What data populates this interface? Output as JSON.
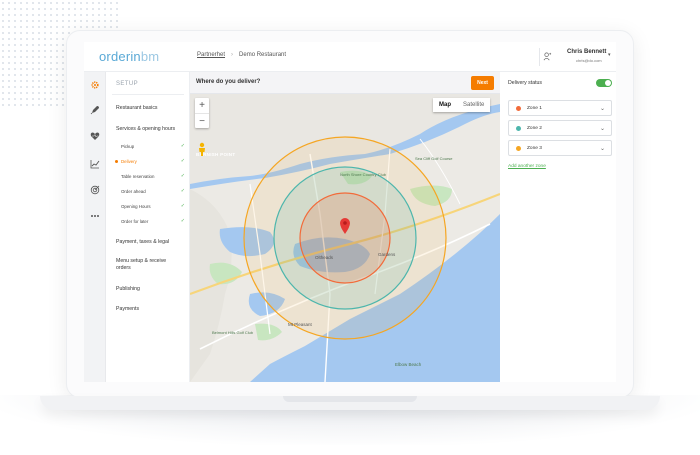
{
  "colors": {
    "accent": "#f57c00",
    "brand": "#5aa9d6",
    "success": "#4caf50",
    "zone1": "#f26b3a",
    "zone2": "#4db6ac",
    "zone3": "#f5a623"
  },
  "header": {
    "logo": {
      "prefix": "orderin",
      "suffix": "bm"
    },
    "breadcrumb": [
      "Partnerhet",
      "Demo Restaurant"
    ],
    "user": {
      "name": "Chris Bennett",
      "email": "chris@do.com"
    }
  },
  "rail": {
    "icons": [
      "gear-icon",
      "rocket-icon",
      "heart-icon",
      "chart-icon",
      "target-icon",
      "more-icon"
    ]
  },
  "nav": {
    "heading": "SETUP",
    "items": {
      "restaurant_basics": "Restaurant basics",
      "services": "Services & opening hours",
      "payment": "Payment, taxes & legal",
      "menu_setup": "Menu setup & receive orders",
      "publishing": "Publishing",
      "payments": "Payments"
    },
    "sub_items": [
      {
        "label": "Pickup",
        "active": false
      },
      {
        "label": "Delivery",
        "active": true
      },
      {
        "label": "Table reservation",
        "active": false
      },
      {
        "label": "Order ahead",
        "active": false
      },
      {
        "label": "Opening Hours",
        "active": false
      },
      {
        "label": "Order for later",
        "active": false
      }
    ]
  },
  "main": {
    "question": "Where do you deliver?",
    "next_label": "Next",
    "map": {
      "zoom_in": "+",
      "zoom_out": "−",
      "type_map": "Map",
      "type_satellite": "Satellite",
      "selected_type": "Map",
      "places": [
        {
          "name": "BARNISH POINT"
        },
        {
          "name": "North Shore Country Club"
        },
        {
          "name": "Sea Cliff Golf Course"
        },
        {
          "name": "Gardens"
        },
        {
          "name": "Mt Pleasant"
        },
        {
          "name": "Oltheads"
        },
        {
          "name": "Elbow Beach"
        },
        {
          "name": "Belmont Hills Golf Club"
        }
      ]
    }
  },
  "right": {
    "delivery_status_label": "Delivery status",
    "delivery_status_on": true,
    "zones": [
      {
        "label": "Zone 1",
        "color": "#f26b3a"
      },
      {
        "label": "Zone 2",
        "color": "#4db6ac"
      },
      {
        "label": "Zone 3",
        "color": "#f5a623"
      }
    ],
    "add_zone_label": "Add another zone"
  }
}
